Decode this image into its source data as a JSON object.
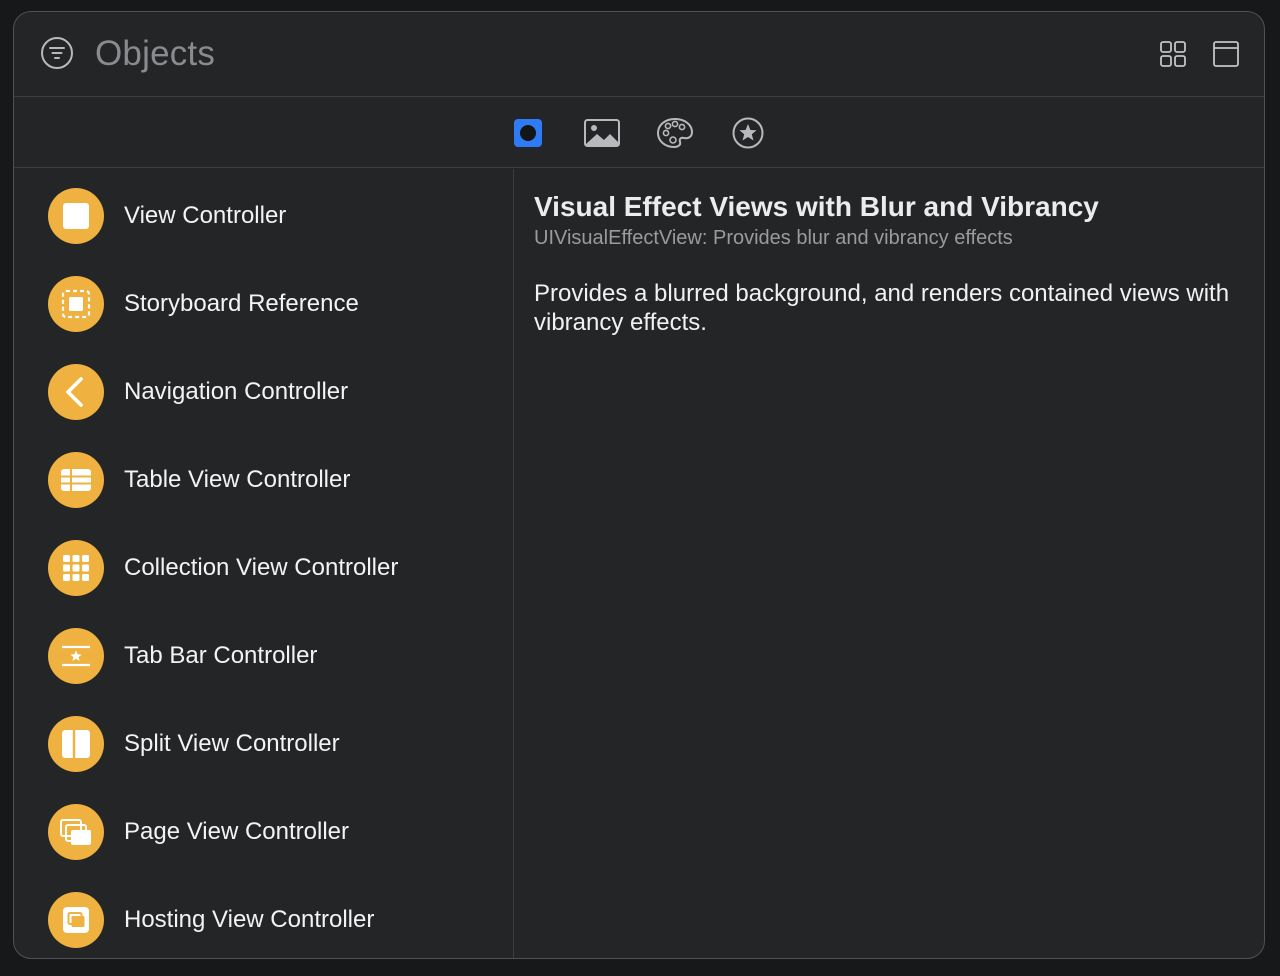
{
  "header": {
    "title": "Objects",
    "filter_icon": "filter-icon",
    "grid_icon": "grid-view-icon",
    "window_icon": "window-icon"
  },
  "tabs": [
    {
      "name": "objects",
      "icon": "objects-icon",
      "selected": true
    },
    {
      "name": "media",
      "icon": "image-icon",
      "selected": false
    },
    {
      "name": "colors",
      "icon": "palette-icon",
      "selected": false
    },
    {
      "name": "symbols",
      "icon": "star-circle-icon",
      "selected": false
    }
  ],
  "items": [
    {
      "label": "View Controller",
      "icon": "view-controller-icon"
    },
    {
      "label": "Storyboard Reference",
      "icon": "storyboard-reference-icon"
    },
    {
      "label": "Navigation Controller",
      "icon": "chevron-left-icon"
    },
    {
      "label": "Table View Controller",
      "icon": "table-icon"
    },
    {
      "label": "Collection View Controller",
      "icon": "collection-grid-icon"
    },
    {
      "label": "Tab Bar Controller",
      "icon": "tab-bar-icon"
    },
    {
      "label": "Split View Controller",
      "icon": "split-view-icon"
    },
    {
      "label": "Page View Controller",
      "icon": "page-view-icon"
    },
    {
      "label": "Hosting View Controller",
      "icon": "hosting-view-icon"
    }
  ],
  "detail": {
    "title": "Visual Effect Views with Blur and Vibrancy",
    "subtitle": "UIVisualEffectView: Provides blur and vibrancy effects",
    "description": "Provides a blurred background, and renders contained views with vibrancy effects."
  },
  "colors": {
    "accent": "#2f7bf5",
    "item_icon_bg": "#efb13f"
  }
}
